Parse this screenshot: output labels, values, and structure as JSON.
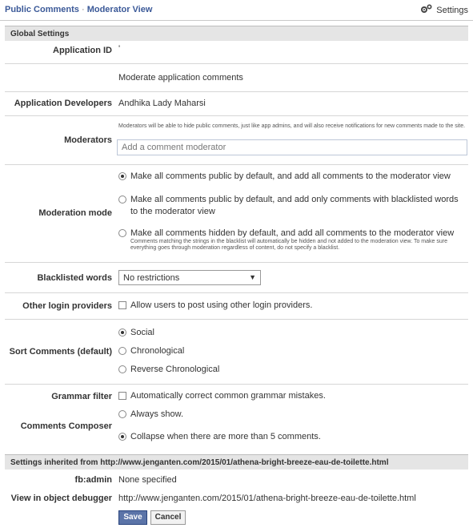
{
  "header": {
    "app_name": "Public Comments",
    "separator": "·",
    "view_name": "Moderator View",
    "settings_label": "Settings"
  },
  "sections": {
    "global_title": "Global Settings",
    "inherited_title": "Settings inherited from http://www.jenganten.com/2015/01/athena-bright-breeze-eau-de-toilette.html"
  },
  "fields": {
    "app_id_label": "Application ID",
    "app_id_value": "'",
    "app_desc_value": "Moderate application comments",
    "developers_label": "Application Developers",
    "developers_value": "Andhika Lady Maharsi",
    "moderators_label": "Moderators",
    "moderators_help": "Moderators will be able to hide public comments, just like app admins, and will also receive notifications for new comments made to the site.",
    "moderators_placeholder": "Add a comment moderator",
    "moderation_label": "Moderation mode",
    "moderation_options": [
      {
        "label": "Make all comments public by default, and add all comments to the moderator view",
        "selected": true
      },
      {
        "label": "Make all comments public by default, and add only comments with blacklisted words to the moderator view",
        "selected": false
      },
      {
        "label": "Make all comments hidden by default, and add all comments to the moderator view",
        "selected": false
      }
    ],
    "moderation_note": "Comments matching the strings in the blacklist will automatically be hidden and not added to the moderation view. To make sure everything goes through moderation regardless of content, do not specify a blacklist.",
    "blacklist_label": "Blacklisted words",
    "blacklist_value": "No restrictions",
    "login_label": "Other login providers",
    "login_option": "Allow users to post using other login providers.",
    "sort_label": "Sort Comments (default)",
    "sort_options": [
      {
        "label": "Social",
        "selected": true
      },
      {
        "label": "Chronological",
        "selected": false
      },
      {
        "label": "Reverse Chronological",
        "selected": false
      }
    ],
    "grammar_label": "Grammar filter",
    "grammar_option": "Automatically correct common grammar mistakes.",
    "composer_label": "Comments Composer",
    "composer_options": [
      {
        "label": "Always show.",
        "selected": false
      },
      {
        "label": "Collapse when there are more than 5 comments.",
        "selected": true
      }
    ],
    "fbadmin_label": "fb:admin",
    "fbadmin_value": "None specified",
    "debugger_label": "View in object debugger",
    "debugger_value": "http://www.jenganten.com/2015/01/athena-bright-breeze-eau-de-toilette.html"
  },
  "buttons": {
    "save": "Save",
    "cancel": "Cancel"
  },
  "icons": {
    "settings": "gear-icon",
    "dropdown": "chevron-down-icon"
  }
}
